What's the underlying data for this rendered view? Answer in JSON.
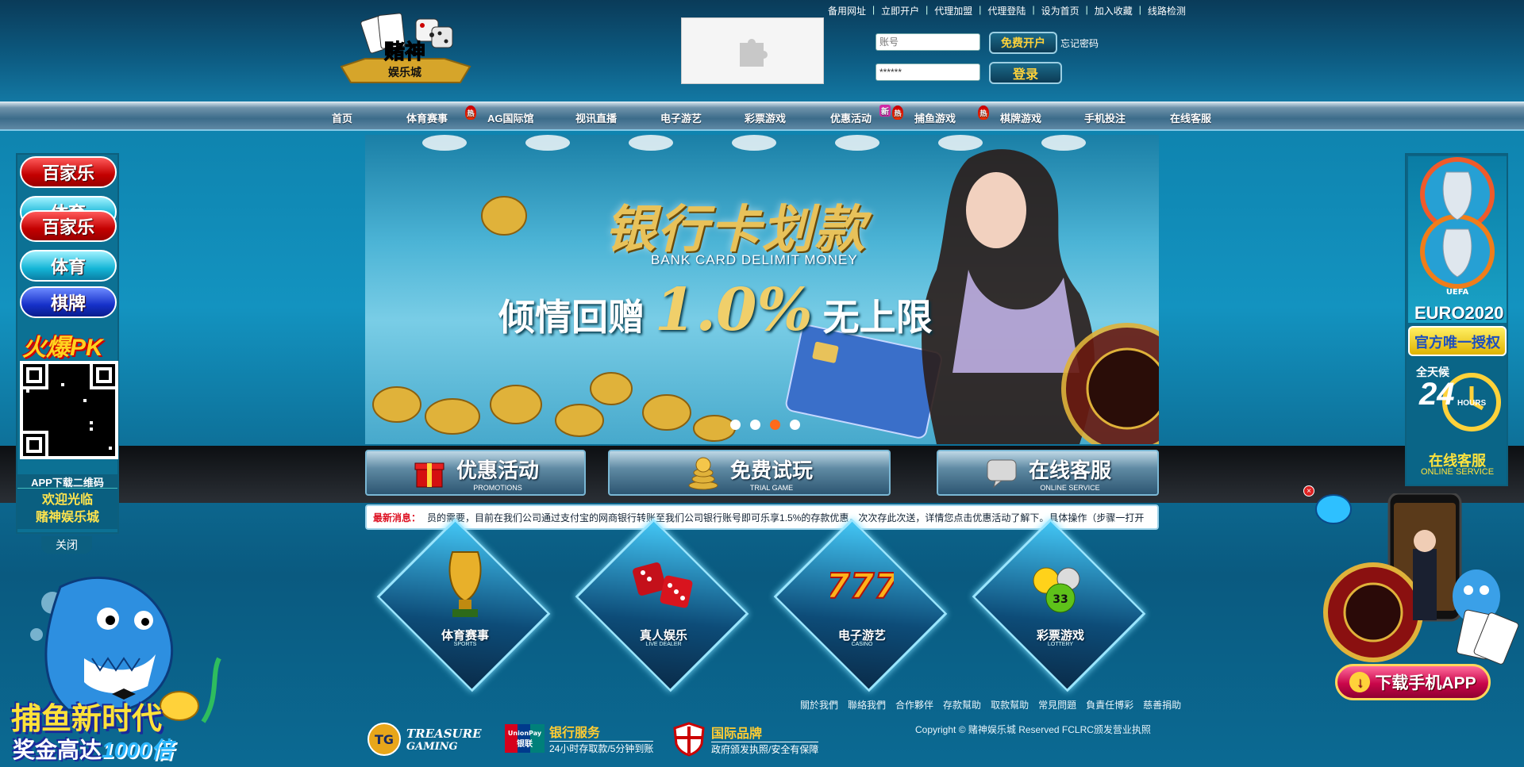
{
  "top_links": [
    "备用网址",
    "立即开户",
    "代理加盟",
    "代理登陆",
    "设为首页",
    "加入收藏",
    "线路检测"
  ],
  "logo": {
    "line1": "赌神",
    "line2": "娱乐城"
  },
  "login": {
    "username_placeholder": "账号",
    "password_value": "******",
    "register_label": "免费开户",
    "forgot_label": "忘记密码",
    "login_label": "登录"
  },
  "nav": [
    {
      "label": "首页"
    },
    {
      "label": "体育赛事"
    },
    {
      "label": "AG国际馆",
      "badge": "hot"
    },
    {
      "label": "视讯直播"
    },
    {
      "label": "电子游艺"
    },
    {
      "label": "彩票游戏"
    },
    {
      "label": "优惠活动",
      "badge": "new"
    },
    {
      "label": "捕鱼游戏",
      "badge": "hot"
    },
    {
      "label": "棋牌游戏",
      "badge": "hot"
    },
    {
      "label": "手机投注"
    },
    {
      "label": "在线客服"
    }
  ],
  "nav_badges": {
    "hot": "热",
    "new": "新"
  },
  "banner": {
    "title": "银行卡划款",
    "subtitle": "BANK CARD DELIMIT MONEY",
    "promo_prefix": "倾情回赠",
    "promo_value": "1.0%",
    "promo_suffix": "无上限",
    "slides": 4,
    "active_slide": 3
  },
  "features": [
    {
      "title": "优惠活动",
      "sub": "PROMOTIONS",
      "icon": "gift-icon"
    },
    {
      "title": "免费试玩",
      "sub": "TRIAL GAME",
      "icon": "coins-icon"
    },
    {
      "title": "在线客服",
      "sub": "ONLINE SERVICE",
      "icon": "chat-icon"
    }
  ],
  "marquee": {
    "label": "最新消息：",
    "text": "员的需要，目前在我们公司通过支付宝的网商银行转账至我们公司银行账号即可乐享1.5%的存款优惠，次次存此次送，详情您点击优惠活动了解下。具体操作（步骤一打开"
  },
  "games": [
    {
      "title": "体育赛事",
      "sub": "SPORTS",
      "icon": "trophy-icon"
    },
    {
      "title": "真人娱乐",
      "sub": "LIVE DEALER",
      "icon": "dice-icon"
    },
    {
      "title": "电子游艺",
      "sub": "CASINO",
      "icon": "slot-777-icon"
    },
    {
      "title": "彩票游戏",
      "sub": "LOTTERY",
      "icon": "lottery-balls-icon"
    }
  ],
  "footer": {
    "links": [
      "關於我們",
      "聯絡我們",
      "合作夥伴",
      "存款幫助",
      "取款幫助",
      "常見問題",
      "負責任博彩",
      "慈善捐助"
    ],
    "copyright": "Copyright © 赌神娱乐城 Reserved FCLRC颁发营业执照",
    "partners": [
      {
        "logo_text": "TREASURE",
        "logo_text2": "GAMING",
        "icon": "tg-logo-icon"
      },
      {
        "title": "银行服务",
        "desc": "24小时存取款/5分钟到账",
        "icon": "unionpay-icon",
        "logo_text": "UnionPay",
        "logo_text2": "银联"
      },
      {
        "title": "国际品牌",
        "desc": "政府颁发执照/安全有保障",
        "icon": "shield-icon"
      }
    ]
  },
  "left_float": {
    "items": [
      {
        "label": "百家乐",
        "style": "red"
      },
      {
        "label": "体育",
        "style": "cyan"
      },
      {
        "label": "百家乐",
        "style": "red"
      },
      {
        "label": "体育",
        "style": "cyan"
      },
      {
        "label": "棋牌",
        "style": "blue"
      }
    ],
    "pk_label": "火爆PK",
    "qr_label": "APP下载二维码",
    "welcome_line1": "欢迎光临",
    "welcome_line2": "赌神娱乐城",
    "close_label": "关闭",
    "fish_line1": "捕鱼新时代",
    "fish_line2": "奖金高达",
    "fish_highlight": "1000倍"
  },
  "right_float": {
    "euro_label": "EURO2020",
    "uefa": "UEFA",
    "auth_label": "官方唯一授权",
    "allday": "全天候",
    "hours_num": "24",
    "hours": "HOURS",
    "service": "在线客服",
    "service_en": "ONLINE SERVICE",
    "download_label": "下载手机APP"
  },
  "colors": {
    "accent_gold": "#e8c25a",
    "hot_red": "#d10000",
    "nav_bg": "#3c6c8a",
    "page_bg": "#1393c0"
  }
}
